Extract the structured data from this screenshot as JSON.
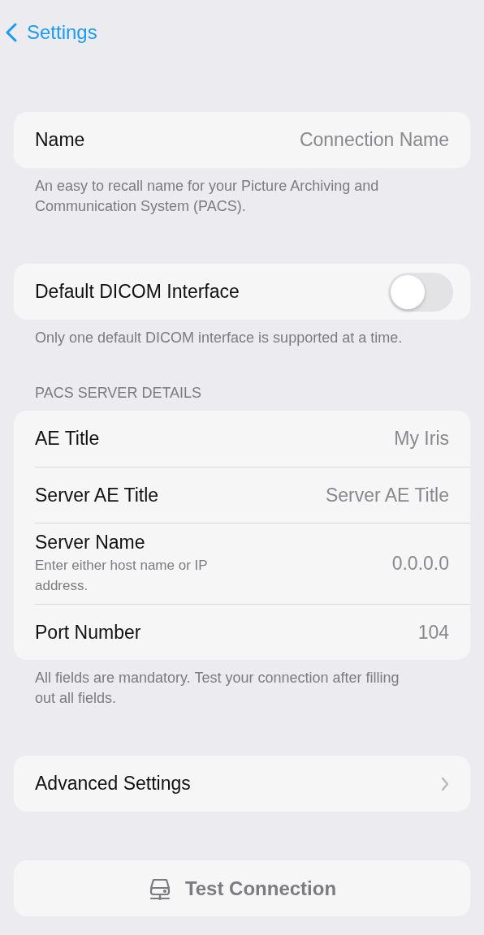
{
  "nav": {
    "back_label": "Settings"
  },
  "sections": [
    {
      "rows": [
        {
          "kind": "field",
          "label": "Name",
          "placeholder": "Connection Name"
        }
      ],
      "footer": "An easy to recall name for your Picture Archiving and Communication System (PACS)."
    },
    {
      "rows": [
        {
          "kind": "toggle",
          "label": "Default DICOM Interface",
          "on": false
        }
      ],
      "footer": "Only one default DICOM interface is supported at a time."
    },
    {
      "header": "PACS SERVER DETAILS",
      "rows": [
        {
          "kind": "field",
          "label": "AE Title",
          "placeholder": "My Iris"
        },
        {
          "kind": "field",
          "label": "Server AE Title",
          "placeholder": "Server AE Title"
        },
        {
          "kind": "field",
          "label": "Server Name",
          "hint": "Enter either host name or IP address.",
          "placeholder": "0.0.0.0"
        },
        {
          "kind": "field",
          "label": "Port Number",
          "placeholder": "104"
        }
      ],
      "footer": "All fields are mandatory. Test your connection after filling out all fields."
    },
    {
      "rows": [
        {
          "kind": "link",
          "label": "Advanced Settings"
        }
      ]
    }
  ],
  "test_button": {
    "label": "Test Connection",
    "disabled": true
  }
}
